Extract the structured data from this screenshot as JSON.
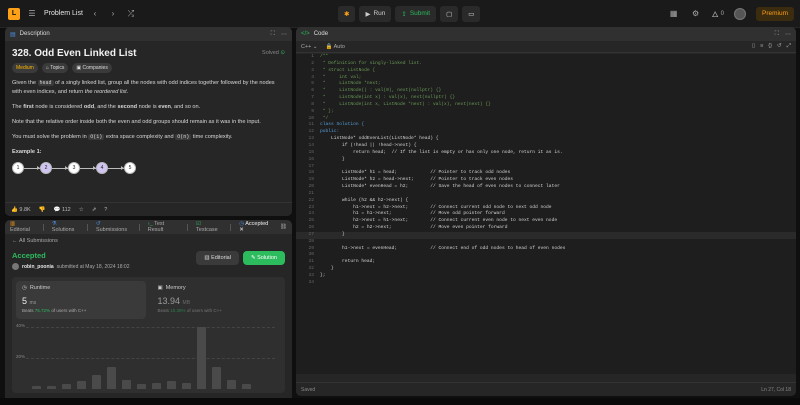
{
  "topbar": {
    "logo": "L",
    "problem_list": "Problem List",
    "run": "Run",
    "submit": "Submit",
    "streak": "0",
    "premium": "Premium"
  },
  "description": {
    "tab": "Description",
    "title": "328. Odd Even Linked List",
    "status": "Solved",
    "tags": {
      "difficulty": "Medium",
      "topics": "Topics",
      "companies": "Companies"
    },
    "p1_a": "Given the ",
    "p1_code": "head",
    "p1_b": " of a singly linked list, group all the nodes with odd indices together followed by the nodes with even indices, and return ",
    "p1_em": "the reordered list",
    "p1_c": ".",
    "p2_a": "The ",
    "p2_b1": "first",
    "p2_b": " node is considered ",
    "p2_b2": "odd",
    "p2_c": ", and the ",
    "p2_b3": "second",
    "p2_d": " node is ",
    "p2_b4": "even",
    "p2_e": ", and so on.",
    "p3": "Note that the relative order inside both the even and odd groups should remain as it was in the input.",
    "p4_a": "You must solve the problem in ",
    "p4_code1": "O(1)",
    "p4_b": " extra space complexity and ",
    "p4_code2": "O(n)",
    "p4_c": " time complexity.",
    "example": "Example 1:",
    "nodes": [
      "1",
      "2",
      "3",
      "4",
      "5"
    ],
    "likes": "9.8K",
    "comments": "112"
  },
  "result": {
    "tabs": [
      "Editorial",
      "Solutions",
      "Submissions",
      "Test Result",
      "Testcase",
      "Accepted"
    ],
    "back": "All Submissions",
    "status": "Accepted",
    "user": "robin_poonia",
    "submitted": "submitted at May 18, 2024 18:02",
    "editorial_btn": "Editorial",
    "solution_btn": "Solution",
    "runtime": {
      "label": "Runtime",
      "value": "5",
      "unit": "ms",
      "beats_prefix": "Beats",
      "beats": "75.72%",
      "beats_suffix": "of users with C++"
    },
    "memory": {
      "label": "Memory",
      "value": "13.94",
      "unit": "MB",
      "beats_prefix": "Beats",
      "beats": "15.35%",
      "beats_suffix": "of users with C++"
    },
    "chart": {
      "y_ticks": [
        "40%",
        "20%"
      ],
      "bars": [
        2,
        2,
        3,
        5,
        9,
        14,
        6,
        3,
        4,
        5,
        4,
        40,
        14,
        6,
        3
      ]
    }
  },
  "editor": {
    "tab": "Code",
    "language": "C++",
    "mode": "Auto",
    "status_left": "Saved",
    "status_right": "Ln 27, Col 18",
    "current_line": 27,
    "lines": [
      "/**",
      " * Definition for singly-linked list.",
      " * struct ListNode {",
      " *     int val;",
      " *     ListNode *next;",
      " *     ListNode() : val(0), next(nullptr) {}",
      " *     ListNode(int x) : val(x), next(nullptr) {}",
      " *     ListNode(int x, ListNode *next) : val(x), next(next) {}",
      " * };",
      " */",
      "class Solution {",
      "public:",
      "    ListNode* oddEvenList(ListNode* head) {",
      "        if (!head || !head->next) {",
      "            return head;  // If the list is empty or has only one node, return it as is.",
      "        }",
      "",
      "        ListNode* h1 = head;            // Pointer to track odd nodes",
      "        ListNode* h2 = head->next;      // Pointer to track even nodes",
      "        ListNode* evenHead = h2;        // Save the head of even nodes to connect later",
      "",
      "        while (h2 && h2->next) {",
      "            h1->next = h2->next;        // Connect current odd node to next odd node",
      "            h1 = h1->next;              // Move odd pointer forward",
      "            h2->next = h1->next;        // Connect current even node to next even node",
      "            h2 = h2->next;              // Move even pointer forward",
      "        }",
      "",
      "        h1->next = evenHead;            // Connect end of odd nodes to head of even nodes",
      "",
      "        return head;",
      "    }",
      "};",
      ""
    ]
  }
}
